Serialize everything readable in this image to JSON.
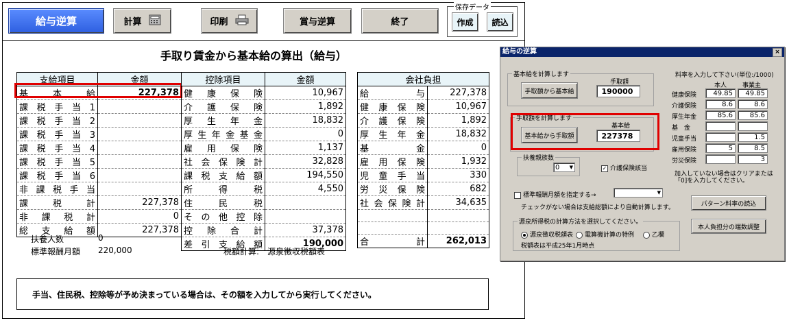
{
  "toolbar": {
    "salary_reverse": "給与逆算",
    "calculate": "計算",
    "print": "印刷",
    "bonus_reverse": "賞与逆算",
    "exit": "終了",
    "save_data": "保存データ",
    "create": "作成",
    "load": "読込"
  },
  "sheet": {
    "title": "手取り賃金から基本給の算出（給与）",
    "pay_header": "支給項目",
    "pay_amount_header": "金額",
    "pay_rows": [
      {
        "label": "基本給",
        "value": "227,378"
      },
      {
        "label": "課税手当1",
        "value": ""
      },
      {
        "label": "課税手当2",
        "value": ""
      },
      {
        "label": "課税手当3",
        "value": ""
      },
      {
        "label": "課税手当4",
        "value": ""
      },
      {
        "label": "課税手当5",
        "value": ""
      },
      {
        "label": "課税手当6",
        "value": ""
      },
      {
        "label": "非課税手当",
        "value": ""
      },
      {
        "label": "課税計",
        "value": "227,378"
      },
      {
        "label": "非課税計",
        "value": "0"
      },
      {
        "label": "総支給額",
        "value": "227,378"
      }
    ],
    "ded_header": "控除項目",
    "ded_amount_header": "金額",
    "ded_rows": [
      {
        "label": "健康保険",
        "value": "10,967"
      },
      {
        "label": "介護保険",
        "value": "1,892"
      },
      {
        "label": "厚生年金",
        "value": "18,832"
      },
      {
        "label": "厚生年金基金",
        "value": "0"
      },
      {
        "label": "雇用保険",
        "value": "1,137"
      },
      {
        "label": "社会保険計",
        "value": "32,828"
      },
      {
        "label": "課税支給額",
        "value": "194,550"
      },
      {
        "label": "所得税",
        "value": "4,550"
      },
      {
        "label": "住民税",
        "value": ""
      },
      {
        "label": "その他控除",
        "value": ""
      },
      {
        "label": "控除合計",
        "value": "37,378"
      },
      {
        "label": "差引支給額",
        "value": "190,000"
      }
    ],
    "comp_header": "会社負担",
    "comp_rows": [
      {
        "label": "給与",
        "value": "227,378"
      },
      {
        "label": "健康保険",
        "value": "10,967"
      },
      {
        "label": "介護保険",
        "value": "1,892"
      },
      {
        "label": "厚生年金",
        "value": "18,832"
      },
      {
        "label": "基金",
        "value": "0"
      },
      {
        "label": "雇用保険",
        "value": "1,932"
      },
      {
        "label": "児童手当",
        "value": "330"
      },
      {
        "label": "労災保険",
        "value": "682"
      },
      {
        "label": "社会保険計",
        "value": "34,635"
      },
      {
        "label": "",
        "value": ""
      },
      {
        "label": "",
        "value": ""
      },
      {
        "label": "合計",
        "value": "262,013"
      }
    ],
    "dependents_label": "扶養人数",
    "dependents_value": "0",
    "standard_label": "標準報酬月額",
    "standard_value": "220,000",
    "tax_calc_label": "税額計算:",
    "tax_calc_value": "源泉徴収税額表",
    "note": "手当、住民税、控除等が予め決まっている場合は、その額を入力してから実行してください。"
  },
  "dialog": {
    "title": "給与の逆算",
    "close": "×",
    "grp_base": "基本給を計算します",
    "takehome_label": "手取額",
    "btn_takehome_to_base": "手取額から基本給",
    "takehome_value": "190000",
    "grp_takehome": "手取額を計算します",
    "base_label": "基本給",
    "btn_base_to_takehome": "基本給から手取額",
    "base_value": "227378",
    "grp_dependents": "扶養親族数",
    "dependents_select": "0",
    "care_check": "介護保険該当",
    "rate_header": "料率を入力して下さい(単位:/1000)",
    "col_self": "本人",
    "col_employer": "事業主",
    "rates": [
      {
        "label": "健康保険",
        "self": "49.85",
        "employer": "49.85"
      },
      {
        "label": "介護保険",
        "self": "8.6",
        "employer": "8.6"
      },
      {
        "label": "厚生年金",
        "self": "85.6",
        "employer": "85.6"
      },
      {
        "label": "基　金",
        "self": "",
        "employer": ""
      },
      {
        "label": "児童手当",
        "self": "",
        "employer": "1.5"
      },
      {
        "label": "雇用保険",
        "self": "5",
        "employer": "8.5"
      },
      {
        "label": "労災保険",
        "self": "",
        "employer": "3"
      }
    ],
    "rate_note": "加入していない場合はクリアまたは「0]を入力してください。",
    "std_check": "標準報酬月額を指定する→",
    "std_note": "チェックがない場合は支給総額により自動計算します。",
    "btn_pattern": "パターン料率の読込",
    "grp_method": "源泉所得税の計算方法を選択してください。",
    "radio_table": "源泉徴収税額表",
    "radio_special": "電算機計算の特例",
    "radio_otsu": "乙欄",
    "method_note": "税額表は平成25年1月時点",
    "btn_adjust": "本人負担分の端数調整"
  }
}
